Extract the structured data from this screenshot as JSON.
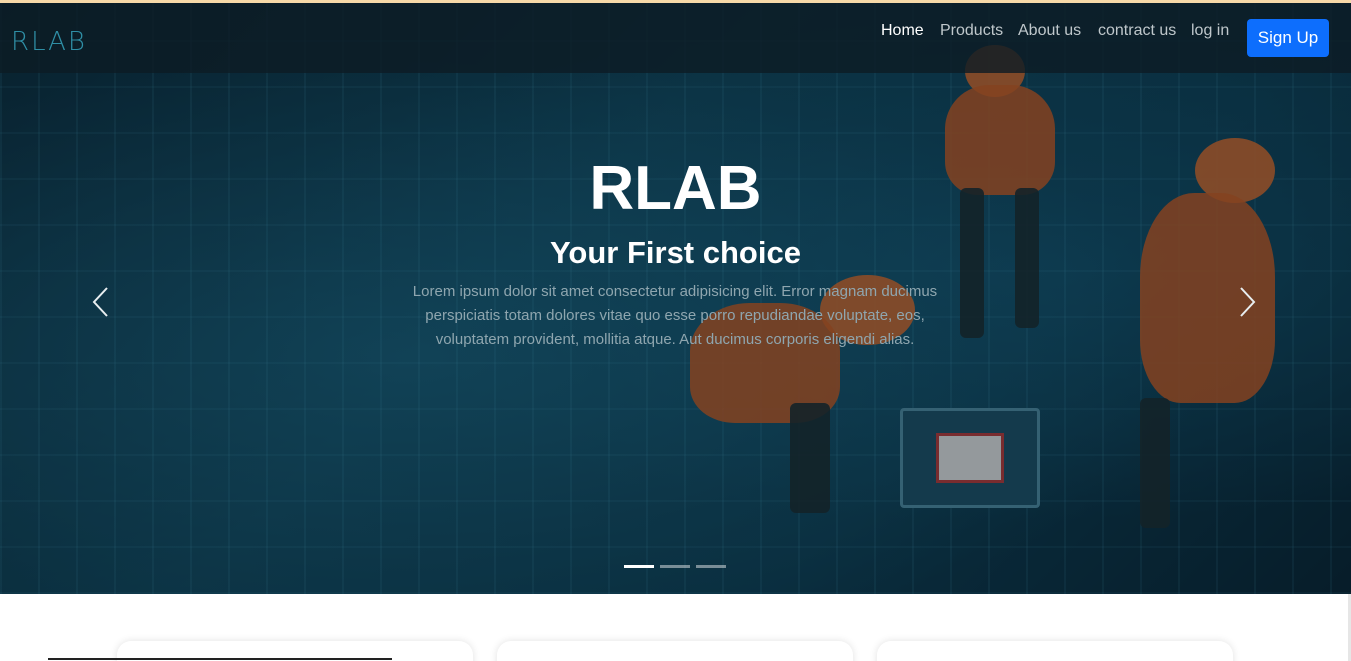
{
  "brand": {
    "logo_text": "RLAB"
  },
  "nav": {
    "links": [
      {
        "label": "Home",
        "active": true
      },
      {
        "label": "Products",
        "active": false
      },
      {
        "label": "About us",
        "active": false
      },
      {
        "label": "contract us",
        "active": false
      },
      {
        "label": "log in",
        "active": false
      }
    ],
    "signup_label": "Sign Up"
  },
  "hero": {
    "title": "RLAB",
    "subtitle": "Your First choice",
    "text": "Lorem ipsum dolor sit amet consectetur adipisicing elit. Error magnam ducimus perspiciatis totam dolores vitae quo esse porro repudiandae voluptate, eos, voluptatem provident, mollitia atque. Aut ducimus corporis eligendi alias.",
    "prev_icon": "chevron-left-icon",
    "next_icon": "chevron-right-icon",
    "slide_count": 3,
    "active_slide": 1
  },
  "colors": {
    "accent": "#0d6efd",
    "logo": "#2f8fa6",
    "nav_text": "#bfc7cb",
    "hero_text": "#8fa6af"
  }
}
